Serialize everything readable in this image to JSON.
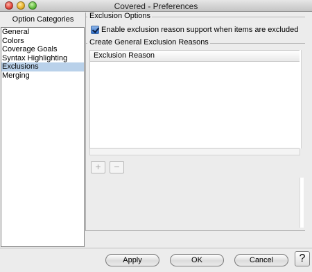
{
  "window": {
    "title": "Covered - Preferences"
  },
  "categories": {
    "header": "Option Categories",
    "items": [
      {
        "label": "General",
        "selected": false
      },
      {
        "label": "Colors",
        "selected": false
      },
      {
        "label": "Coverage Goals",
        "selected": false
      },
      {
        "label": "Syntax Highlighting",
        "selected": false
      },
      {
        "label": "Exclusions",
        "selected": true
      },
      {
        "label": "Merging",
        "selected": false
      }
    ]
  },
  "exclusion_options": {
    "title": "Exclusion Options",
    "checkbox_label": "Enable exclusion reason support when items are excluded",
    "checkbox_checked": true
  },
  "exclusion_reasons": {
    "title": "Create General Exclusion Reasons",
    "column_header": "Exclusion Reason",
    "rows": [],
    "add_label": "+",
    "remove_label": "−"
  },
  "buttons": {
    "apply": "Apply",
    "ok": "OK",
    "cancel": "Cancel",
    "help": "?"
  },
  "colors": {
    "selection": "#b9d1ea",
    "checkbox": "#2f6fcc"
  }
}
